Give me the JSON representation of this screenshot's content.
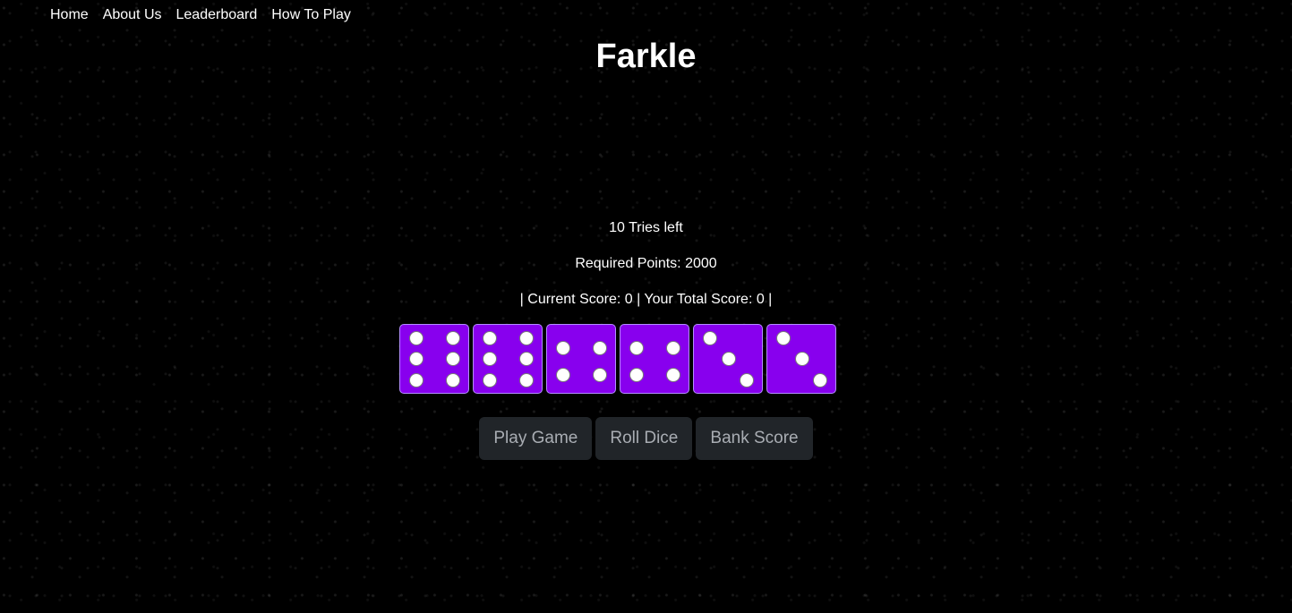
{
  "nav": {
    "items": [
      {
        "label": "Home"
      },
      {
        "label": "About Us"
      },
      {
        "label": "Leaderboard"
      },
      {
        "label": "How To Play"
      }
    ]
  },
  "title": "Farkle",
  "status": {
    "tries_left": "10 Tries left",
    "required_points": "Required Points: 2000",
    "score_line": "| Current Score: 0 | Your Total Score: 0 |"
  },
  "dice": [
    6,
    6,
    4,
    4,
    3,
    3
  ],
  "colors": {
    "background": "#000000",
    "die_face": "#8800ee",
    "pip": "#ffffff",
    "button_bg": "#212529",
    "button_text": "#a9adb3"
  },
  "buttons": {
    "play_game": "Play Game",
    "roll_dice": "Roll Dice",
    "bank_score": "Bank Score"
  }
}
